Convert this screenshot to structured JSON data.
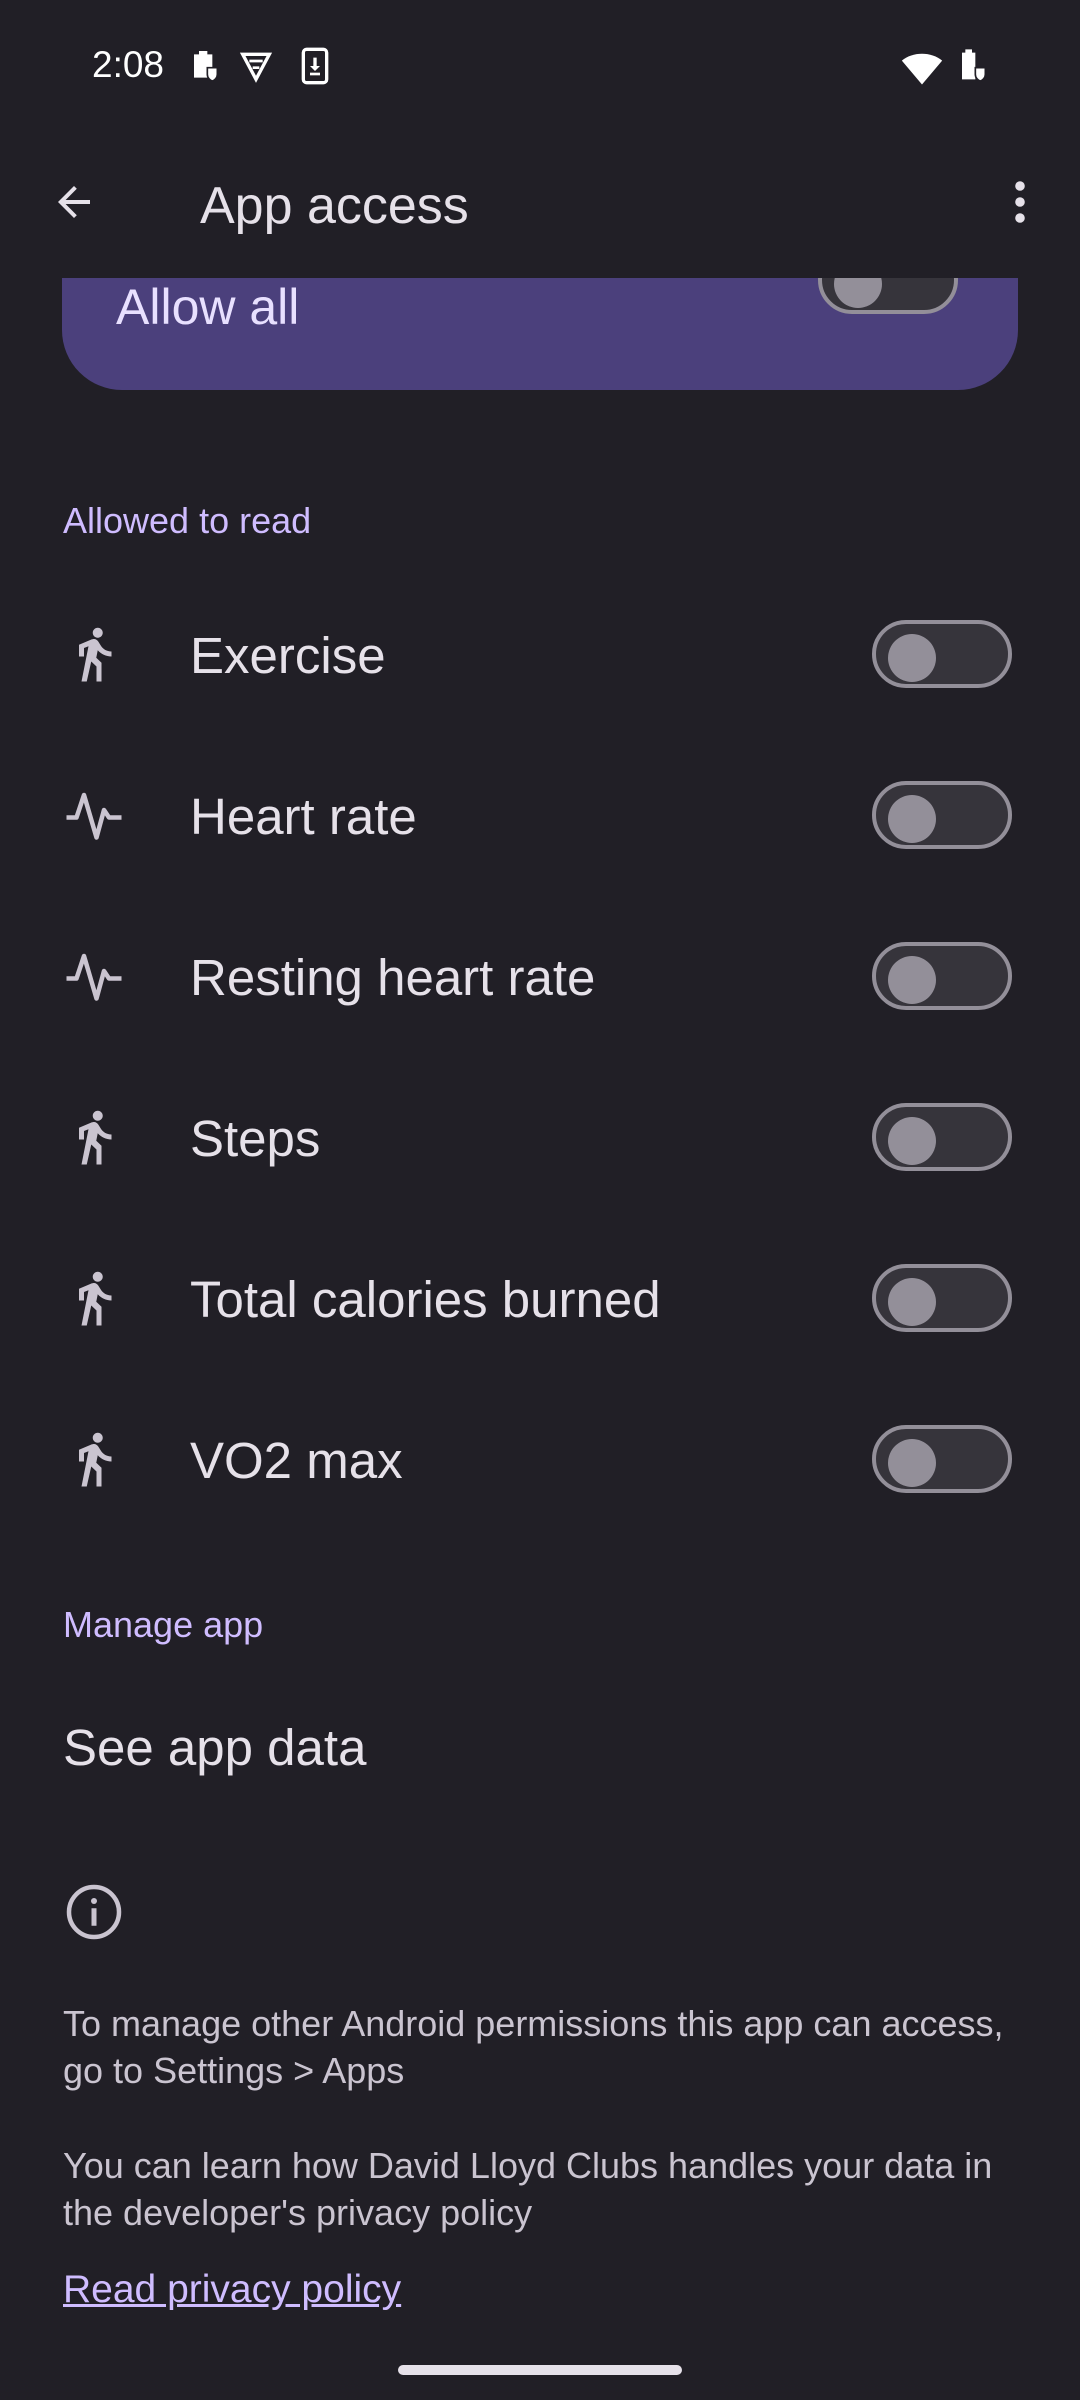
{
  "status_bar": {
    "time": "2:08",
    "icons": [
      "work-badge-icon",
      "vpn-shield-icon",
      "download-icon",
      "wifi-icon",
      "battery-work-icon"
    ]
  },
  "app_bar": {
    "title": "App access",
    "back_icon": "arrow-back-icon",
    "more_icon": "more-vert-icon"
  },
  "allow_all": {
    "label": "Allow all",
    "checked": false
  },
  "allowed_to_read": {
    "header": "Allowed to read",
    "items": [
      {
        "label": "Exercise",
        "icon": "directions-run-icon",
        "checked": false
      },
      {
        "label": "Heart rate",
        "icon": "vitals-icon",
        "checked": false
      },
      {
        "label": "Resting heart rate",
        "icon": "vitals-icon",
        "checked": false
      },
      {
        "label": "Steps",
        "icon": "directions-run-icon",
        "checked": false
      },
      {
        "label": "Total calories burned",
        "icon": "directions-run-icon",
        "checked": false
      },
      {
        "label": "VO2 max",
        "icon": "directions-run-icon",
        "checked": false
      }
    ]
  },
  "manage_app": {
    "header": "Manage app",
    "see_app_data": "See app data"
  },
  "footer": {
    "info_icon": "info-icon",
    "para1": "To manage other Android permissions this app can access, go to Settings > Apps",
    "para2": "You can learn how David Lloyd Clubs handles your data in the developer's privacy policy",
    "link": "Read privacy policy"
  },
  "colors": {
    "background": "#211f26",
    "accent": "#cfbcff",
    "card": "#4b407c",
    "text": "#e6e1e9"
  }
}
